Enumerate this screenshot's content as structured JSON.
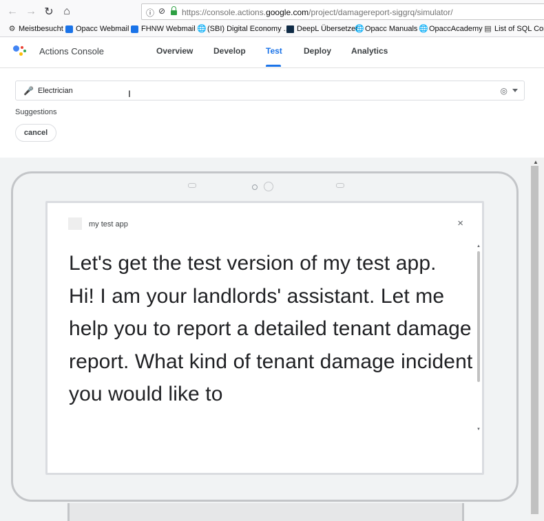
{
  "browser": {
    "url_prefix": "https://console.actions.",
    "url_domain": "google.com",
    "url_path": "/project/damagereport-siggrq/simulator/",
    "bookmarks": [
      {
        "label": "Meistbesucht",
        "icon": "gear-icon"
      },
      {
        "label": "Opacc Webmail",
        "icon": "outlook-icon"
      },
      {
        "label": "FHNW Webmail",
        "icon": "outlook-icon"
      },
      {
        "label": "(SBI) Digital Economy ...",
        "icon": "globe-icon"
      },
      {
        "label": "DeepL Übersetzer",
        "icon": "deepl-icon"
      },
      {
        "label": "Opacc Manuals",
        "icon": "globe-icon"
      },
      {
        "label": "OpaccAcademy",
        "icon": "globe-icon"
      },
      {
        "label": "List of SQL Com",
        "icon": "page-icon"
      }
    ]
  },
  "header": {
    "app_title": "Actions Console",
    "tabs": [
      {
        "label": "Overview",
        "active": false
      },
      {
        "label": "Develop",
        "active": false
      },
      {
        "label": "Test",
        "active": true
      },
      {
        "label": "Deploy",
        "active": false
      },
      {
        "label": "Analytics",
        "active": false
      }
    ],
    "accent_color": "#1a73e8"
  },
  "input": {
    "value": "Electrician"
  },
  "suggestions": {
    "label": "Suggestions",
    "chips": [
      "cancel"
    ]
  },
  "simulator": {
    "app_name": "my test app",
    "close_symbol": "×",
    "lines": [
      "Let's get the test version of my test app.",
      "Hi! I am your landlords' assistant. Let me help you to report a detailed tenant damage report. What kind of tenant damage incident you would like to"
    ]
  }
}
